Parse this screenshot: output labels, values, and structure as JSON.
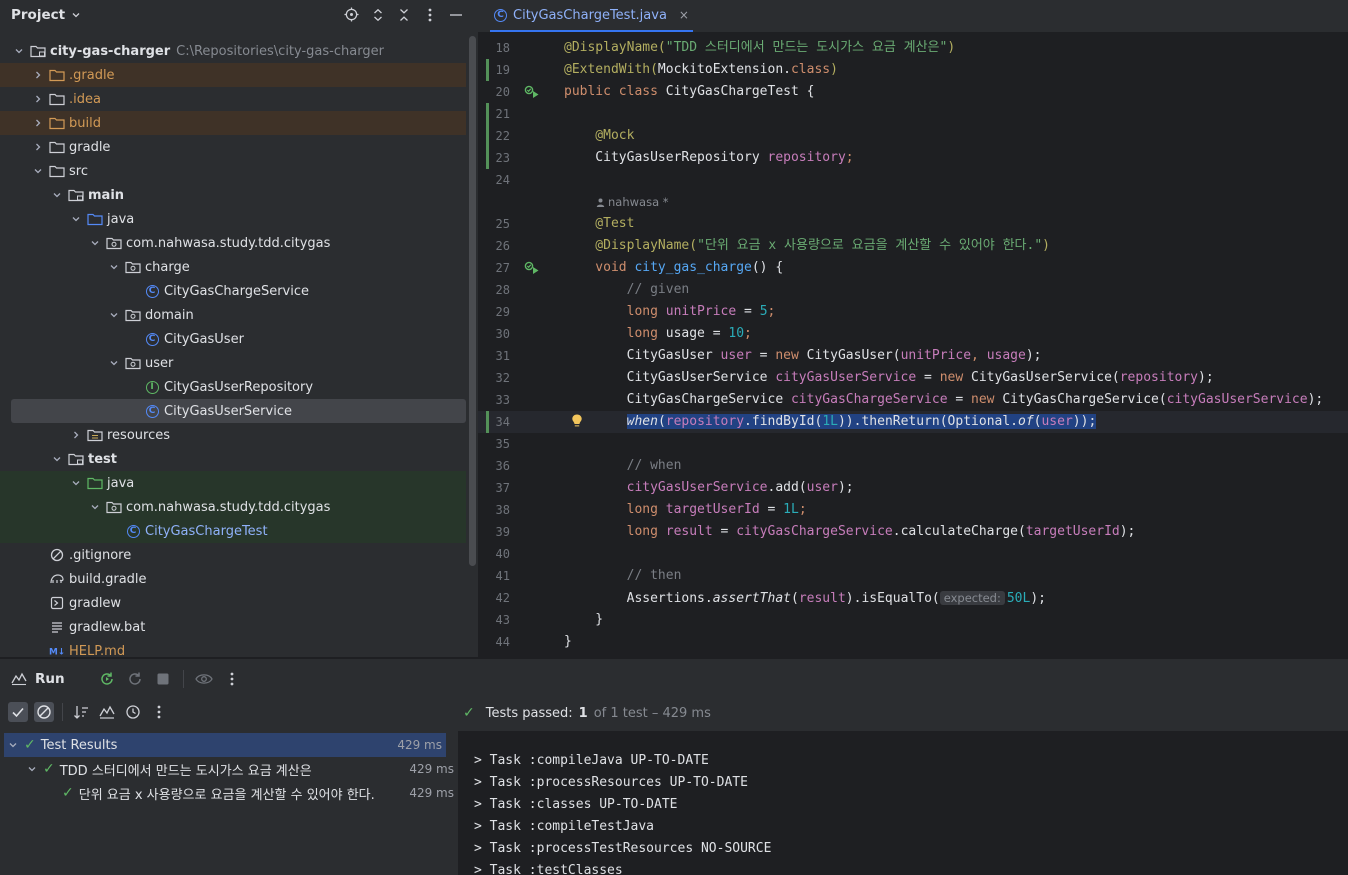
{
  "project": {
    "title": "Project",
    "tree": [
      {
        "label": "city-gas-charger",
        "sub": "C:\\Repositories\\city-gas-charger",
        "depth": 0,
        "icon": "module-folder-icon",
        "expanded": true,
        "bold": true,
        "style": ""
      },
      {
        "label": ".gradle",
        "depth": 1,
        "icon": "folder-excluded-icon",
        "expanded": false,
        "style": "excluded"
      },
      {
        "label": ".idea",
        "depth": 1,
        "icon": "folder-icon",
        "expanded": false,
        "style": "ignored"
      },
      {
        "label": "build",
        "depth": 1,
        "icon": "folder-excluded-icon",
        "expanded": false,
        "style": "excluded"
      },
      {
        "label": "gradle",
        "depth": 1,
        "icon": "folder-icon",
        "expanded": false,
        "style": ""
      },
      {
        "label": "src",
        "depth": 1,
        "icon": "folder-icon",
        "expanded": true,
        "style": ""
      },
      {
        "label": "main",
        "depth": 2,
        "icon": "module-folder-icon",
        "expanded": true,
        "bold": true,
        "style": ""
      },
      {
        "label": "java",
        "depth": 3,
        "icon": "source-folder-icon",
        "expanded": true,
        "style": ""
      },
      {
        "label": "com.nahwasa.study.tdd.citygas",
        "depth": 4,
        "icon": "package-icon",
        "expanded": true,
        "style": ""
      },
      {
        "label": "charge",
        "depth": 5,
        "icon": "package-icon",
        "expanded": true,
        "style": ""
      },
      {
        "label": "CityGasChargeService",
        "depth": 6,
        "icon": "class-icon",
        "leaf": true,
        "style": ""
      },
      {
        "label": "domain",
        "depth": 5,
        "icon": "package-icon",
        "expanded": true,
        "style": ""
      },
      {
        "label": "CityGasUser",
        "depth": 6,
        "icon": "class-icon",
        "leaf": true,
        "style": ""
      },
      {
        "label": "user",
        "depth": 5,
        "icon": "package-icon",
        "expanded": true,
        "style": ""
      },
      {
        "label": "CityGasUserRepository",
        "depth": 6,
        "icon": "interface-icon",
        "leaf": true,
        "style": ""
      },
      {
        "label": "CityGasUserService",
        "depth": 6,
        "icon": "class-icon",
        "leaf": true,
        "style": "selected"
      },
      {
        "label": "resources",
        "depth": 3,
        "icon": "resources-folder-icon",
        "expanded": false,
        "style": ""
      },
      {
        "label": "test",
        "depth": 2,
        "icon": "module-folder-icon",
        "expanded": true,
        "bold": true,
        "style": ""
      },
      {
        "label": "java",
        "depth": 3,
        "icon": "test-folder-icon",
        "expanded": true,
        "style": "testrow"
      },
      {
        "label": "com.nahwasa.study.tdd.citygas",
        "depth": 4,
        "icon": "package-icon",
        "expanded": true,
        "style": "testrow"
      },
      {
        "label": "CityGasChargeTest",
        "depth": 5,
        "icon": "class-icon",
        "leaf": true,
        "style": "testrow",
        "blue": true
      },
      {
        "label": ".gitignore",
        "depth": 1,
        "icon": "ignore-file-icon",
        "leaf": true,
        "style": ""
      },
      {
        "label": "build.gradle",
        "depth": 1,
        "icon": "gradle-icon",
        "leaf": true,
        "style": ""
      },
      {
        "label": "gradlew",
        "depth": 1,
        "icon": "shell-file-icon",
        "leaf": true,
        "style": ""
      },
      {
        "label": "gradlew.bat",
        "depth": 1,
        "icon": "text-file-icon",
        "leaf": true,
        "style": ""
      },
      {
        "label": "HELP.md",
        "depth": 1,
        "icon": "markdown-icon",
        "leaf": true,
        "style": "ignored"
      }
    ]
  },
  "editor": {
    "tab_label": "CityGasChargeTest.java",
    "tab_close": "×",
    "author_hint": "nahwasa *",
    "expected_hint": "expected:",
    "lines": [
      {
        "n": "18",
        "tokens": [
          {
            "t": "@DisplayName(",
            "c": "ann"
          },
          {
            "t": "\"TDD 스터디에서 만드는 도시가스 요금 계산은\"",
            "c": "str"
          },
          {
            "t": ")",
            "c": "ann"
          }
        ]
      },
      {
        "n": "19",
        "mark": true,
        "tokens": [
          {
            "t": "@ExtendWith(",
            "c": "ann"
          },
          {
            "t": "MockitoExtension.",
            "c": ""
          },
          {
            "t": "class",
            "c": "kw"
          },
          {
            "t": ")",
            "c": "ann"
          }
        ]
      },
      {
        "n": "20",
        "run": true,
        "tokens": [
          {
            "t": "public",
            "c": "kw"
          },
          {
            "t": " ",
            "c": ""
          },
          {
            "t": "class",
            "c": "kw"
          },
          {
            "t": " CityGasChargeTest {",
            "c": ""
          }
        ]
      },
      {
        "n": "21",
        "mark": true,
        "tokens": []
      },
      {
        "n": "22",
        "mark": true,
        "tokens": [
          {
            "t": "    @Mock",
            "c": "ann"
          }
        ]
      },
      {
        "n": "23",
        "mark": true,
        "tokens": [
          {
            "t": "    CityGasUserRepository ",
            "c": ""
          },
          {
            "t": "repository",
            "c": "fld"
          },
          {
            "t": ";",
            "c": "kw"
          }
        ]
      },
      {
        "n": "24",
        "tokens": []
      },
      {
        "n": "",
        "author": true,
        "tokens": []
      },
      {
        "n": "25",
        "tokens": [
          {
            "t": "    @Test",
            "c": "ann"
          }
        ]
      },
      {
        "n": "26",
        "tokens": [
          {
            "t": "    @DisplayName(",
            "c": "ann"
          },
          {
            "t": "\"단위 요금 x 사용량으로 요금을 계산할 수 있어야 한다.\"",
            "c": "str"
          },
          {
            "t": ")",
            "c": "ann"
          }
        ]
      },
      {
        "n": "27",
        "run": true,
        "tokens": [
          {
            "t": "    void ",
            "c": "kw"
          },
          {
            "t": "city_gas_charge",
            "c": "fn"
          },
          {
            "t": "() {",
            "c": ""
          }
        ]
      },
      {
        "n": "28",
        "tokens": [
          {
            "t": "        // given",
            "c": "cmt"
          }
        ]
      },
      {
        "n": "29",
        "tokens": [
          {
            "t": "        long ",
            "c": "kw"
          },
          {
            "t": "unitPrice",
            "c": "fld"
          },
          {
            "t": " = ",
            "c": ""
          },
          {
            "t": "5",
            "c": "numl"
          },
          {
            "t": ";",
            "c": "kw"
          }
        ]
      },
      {
        "n": "30",
        "tokens": [
          {
            "t": "        long ",
            "c": "kw"
          },
          {
            "t": "usage",
            "c": ""
          },
          {
            "t": " = ",
            "c": ""
          },
          {
            "t": "10",
            "c": "numl"
          },
          {
            "t": ";",
            "c": "kw"
          }
        ]
      },
      {
        "n": "31",
        "tokens": [
          {
            "t": "        CityGasUser ",
            "c": ""
          },
          {
            "t": "user",
            "c": "fld"
          },
          {
            "t": " = ",
            "c": ""
          },
          {
            "t": "new ",
            "c": "kw"
          },
          {
            "t": "CityGasUser(",
            "c": ""
          },
          {
            "t": "unitPrice",
            "c": "fld"
          },
          {
            "t": ", ",
            "c": "kw"
          },
          {
            "t": "usage",
            "c": "fld"
          },
          {
            "t": ");",
            "c": ""
          }
        ]
      },
      {
        "n": "32",
        "tokens": [
          {
            "t": "        CityGasUserService ",
            "c": ""
          },
          {
            "t": "cityGasUserService",
            "c": "fld"
          },
          {
            "t": " = ",
            "c": ""
          },
          {
            "t": "new ",
            "c": "kw"
          },
          {
            "t": "CityGasUserService(",
            "c": ""
          },
          {
            "t": "repository",
            "c": "fld"
          },
          {
            "t": ");",
            "c": ""
          }
        ]
      },
      {
        "n": "33",
        "tokens": [
          {
            "t": "        CityGasChargeService ",
            "c": ""
          },
          {
            "t": "cityGasChargeService",
            "c": "fld"
          },
          {
            "t": " = ",
            "c": ""
          },
          {
            "t": "new ",
            "c": "kw"
          },
          {
            "t": "CityGasChargeService(",
            "c": ""
          },
          {
            "t": "cityGasUserService",
            "c": "fld"
          },
          {
            "t": ");",
            "c": ""
          }
        ]
      },
      {
        "n": "34",
        "mark": true,
        "current": true,
        "bulb": true,
        "tokens": [
          {
            "t": "        ",
            "c": ""
          },
          {
            "t": "when",
            "c": "it sel"
          },
          {
            "t": "(",
            "c": "sel"
          },
          {
            "t": "repository",
            "c": "fld sel"
          },
          {
            "t": ".findById(",
            "c": "sel"
          },
          {
            "t": "1L",
            "c": "numl sel"
          },
          {
            "t": ")).thenReturn(Optional.",
            "c": "sel"
          },
          {
            "t": "of",
            "c": "it sel"
          },
          {
            "t": "(",
            "c": "sel"
          },
          {
            "t": "user",
            "c": "fld sel"
          },
          {
            "t": "));",
            "c": "sel"
          }
        ]
      },
      {
        "n": "35",
        "tokens": []
      },
      {
        "n": "36",
        "tokens": [
          {
            "t": "        // when",
            "c": "cmt"
          }
        ]
      },
      {
        "n": "37",
        "tokens": [
          {
            "t": "        ",
            "c": ""
          },
          {
            "t": "cityGasUserService",
            "c": "fld"
          },
          {
            "t": ".add(",
            "c": ""
          },
          {
            "t": "user",
            "c": "fld"
          },
          {
            "t": ");",
            "c": ""
          }
        ]
      },
      {
        "n": "38",
        "tokens": [
          {
            "t": "        long ",
            "c": "kw"
          },
          {
            "t": "targetUserId",
            "c": "fld"
          },
          {
            "t": " = ",
            "c": ""
          },
          {
            "t": "1L",
            "c": "numl"
          },
          {
            "t": ";",
            "c": "kw"
          }
        ]
      },
      {
        "n": "39",
        "tokens": [
          {
            "t": "        long ",
            "c": "kw"
          },
          {
            "t": "result",
            "c": "fld"
          },
          {
            "t": " = ",
            "c": ""
          },
          {
            "t": "cityGasChargeService",
            "c": "fld"
          },
          {
            "t": ".calculateCharge(",
            "c": ""
          },
          {
            "t": "targetUserId",
            "c": "fld"
          },
          {
            "t": ");",
            "c": ""
          }
        ]
      },
      {
        "n": "40",
        "tokens": []
      },
      {
        "n": "41",
        "tokens": [
          {
            "t": "        // then",
            "c": "cmt"
          }
        ]
      },
      {
        "n": "42",
        "hint": true,
        "tokens": [
          {
            "t": "        Assertions.",
            "c": ""
          },
          {
            "t": "assertThat",
            "c": "it"
          },
          {
            "t": "(",
            "c": ""
          },
          {
            "t": "result",
            "c": "fld"
          },
          {
            "t": ").isEqualTo(",
            "c": ""
          },
          {
            "t": "__HINT__",
            "c": ""
          },
          {
            "t": "50L",
            "c": "numl"
          },
          {
            "t": ");",
            "c": ""
          }
        ]
      },
      {
        "n": "43",
        "tokens": [
          {
            "t": "    }",
            "c": ""
          }
        ]
      },
      {
        "n": "44",
        "tokens": [
          {
            "t": "}",
            "c": ""
          }
        ]
      }
    ]
  },
  "run": {
    "title": "Run",
    "summary": {
      "passed_label": "Tests passed:",
      "passed_count": "1",
      "rest": "of 1 test – 429 ms"
    },
    "results": [
      {
        "label": "Test Results",
        "duration": "429 ms",
        "depth": 0,
        "selected": true
      },
      {
        "label": "TDD 스터디에서 만드는 도시가스 요금 계산은",
        "duration": "429 ms",
        "depth": 1
      },
      {
        "label": "단위 요금 x 사용량으로 요금을 계산할 수 있어야 한다.",
        "duration": "429 ms",
        "depth": 2
      }
    ],
    "console": [
      "> Task :compileJava UP-TO-DATE",
      "> Task :processResources UP-TO-DATE",
      "> Task :classes UP-TO-DATE",
      "> Task :compileTestJava",
      "> Task :processTestResources NO-SOURCE",
      "> Task :testClasses"
    ]
  }
}
